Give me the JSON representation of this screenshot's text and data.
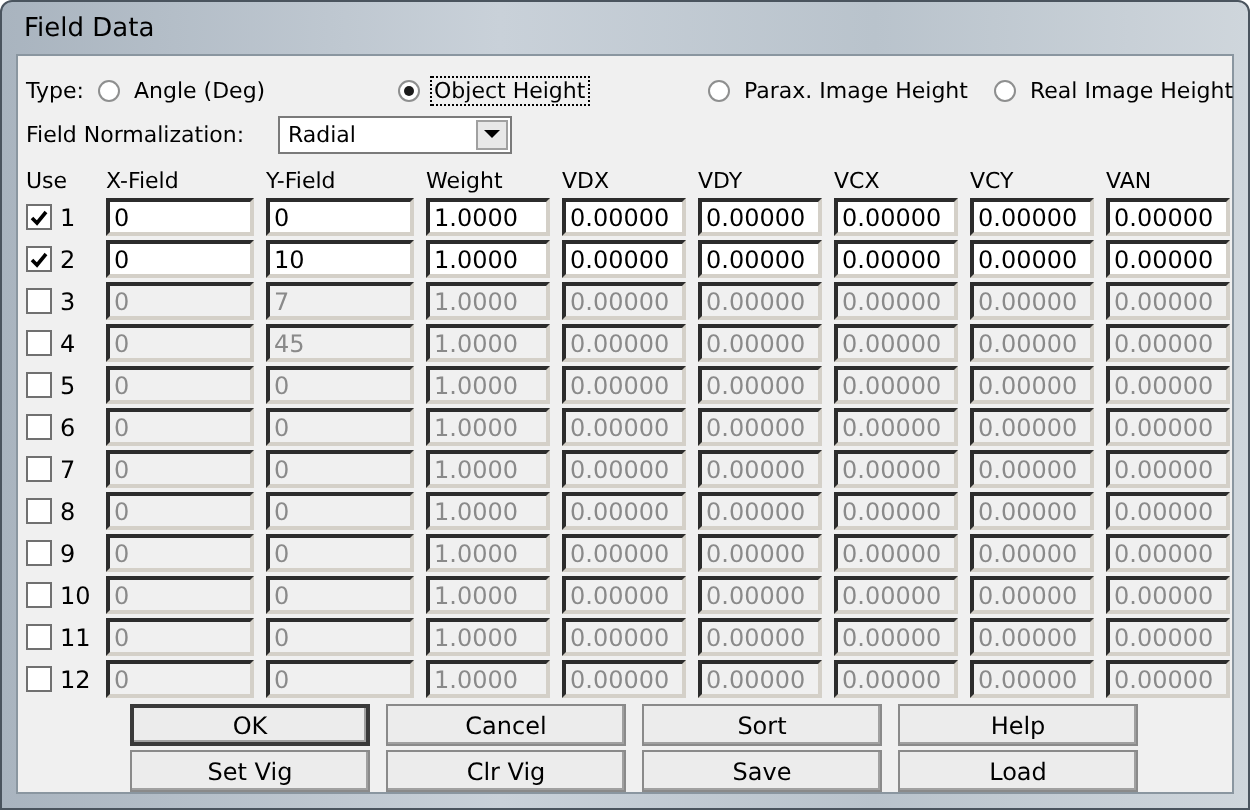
{
  "window": {
    "title": "Field Data"
  },
  "type": {
    "label": "Type:",
    "options": [
      {
        "label": "Angle (Deg)",
        "selected": false
      },
      {
        "label": "Object Height",
        "selected": true
      },
      {
        "label": "Parax. Image Height",
        "selected": false
      },
      {
        "label": "Real Image Height",
        "selected": false
      }
    ]
  },
  "normalization": {
    "label": "Field Normalization:",
    "value": "Radial"
  },
  "table": {
    "columns": [
      "Use",
      "X-Field",
      "Y-Field",
      "Weight",
      "VDX",
      "VDY",
      "VCX",
      "VCY",
      "VAN"
    ],
    "rows": [
      {
        "number": "1",
        "checked": true,
        "values": [
          "0",
          "0",
          "1.0000",
          "0.00000",
          "0.00000",
          "0.00000",
          "0.00000",
          "0.00000"
        ]
      },
      {
        "number": "2",
        "checked": true,
        "values": [
          "0",
          "10",
          "1.0000",
          "0.00000",
          "0.00000",
          "0.00000",
          "0.00000",
          "0.00000"
        ]
      },
      {
        "number": "3",
        "checked": false,
        "values": [
          "0",
          "7",
          "1.0000",
          "0.00000",
          "0.00000",
          "0.00000",
          "0.00000",
          "0.00000"
        ]
      },
      {
        "number": "4",
        "checked": false,
        "values": [
          "0",
          "45",
          "1.0000",
          "0.00000",
          "0.00000",
          "0.00000",
          "0.00000",
          "0.00000"
        ]
      },
      {
        "number": "5",
        "checked": false,
        "values": [
          "0",
          "0",
          "1.0000",
          "0.00000",
          "0.00000",
          "0.00000",
          "0.00000",
          "0.00000"
        ]
      },
      {
        "number": "6",
        "checked": false,
        "values": [
          "0",
          "0",
          "1.0000",
          "0.00000",
          "0.00000",
          "0.00000",
          "0.00000",
          "0.00000"
        ]
      },
      {
        "number": "7",
        "checked": false,
        "values": [
          "0",
          "0",
          "1.0000",
          "0.00000",
          "0.00000",
          "0.00000",
          "0.00000",
          "0.00000"
        ]
      },
      {
        "number": "8",
        "checked": false,
        "values": [
          "0",
          "0",
          "1.0000",
          "0.00000",
          "0.00000",
          "0.00000",
          "0.00000",
          "0.00000"
        ]
      },
      {
        "number": "9",
        "checked": false,
        "values": [
          "0",
          "0",
          "1.0000",
          "0.00000",
          "0.00000",
          "0.00000",
          "0.00000",
          "0.00000"
        ]
      },
      {
        "number": "10",
        "checked": false,
        "values": [
          "0",
          "0",
          "1.0000",
          "0.00000",
          "0.00000",
          "0.00000",
          "0.00000",
          "0.00000"
        ]
      },
      {
        "number": "11",
        "checked": false,
        "values": [
          "0",
          "0",
          "1.0000",
          "0.00000",
          "0.00000",
          "0.00000",
          "0.00000",
          "0.00000"
        ]
      },
      {
        "number": "12",
        "checked": false,
        "values": [
          "0",
          "0",
          "1.0000",
          "0.00000",
          "0.00000",
          "0.00000",
          "0.00000",
          "0.00000"
        ]
      }
    ]
  },
  "buttons": [
    {
      "label": "OK",
      "selected": true
    },
    {
      "label": "Cancel",
      "selected": false
    },
    {
      "label": "Sort",
      "selected": false
    },
    {
      "label": "Help",
      "selected": false
    },
    {
      "label": "Set Vig",
      "selected": false
    },
    {
      "label": "Clr Vig",
      "selected": false
    },
    {
      "label": "Save",
      "selected": false
    },
    {
      "label": "Load",
      "selected": false
    }
  ]
}
